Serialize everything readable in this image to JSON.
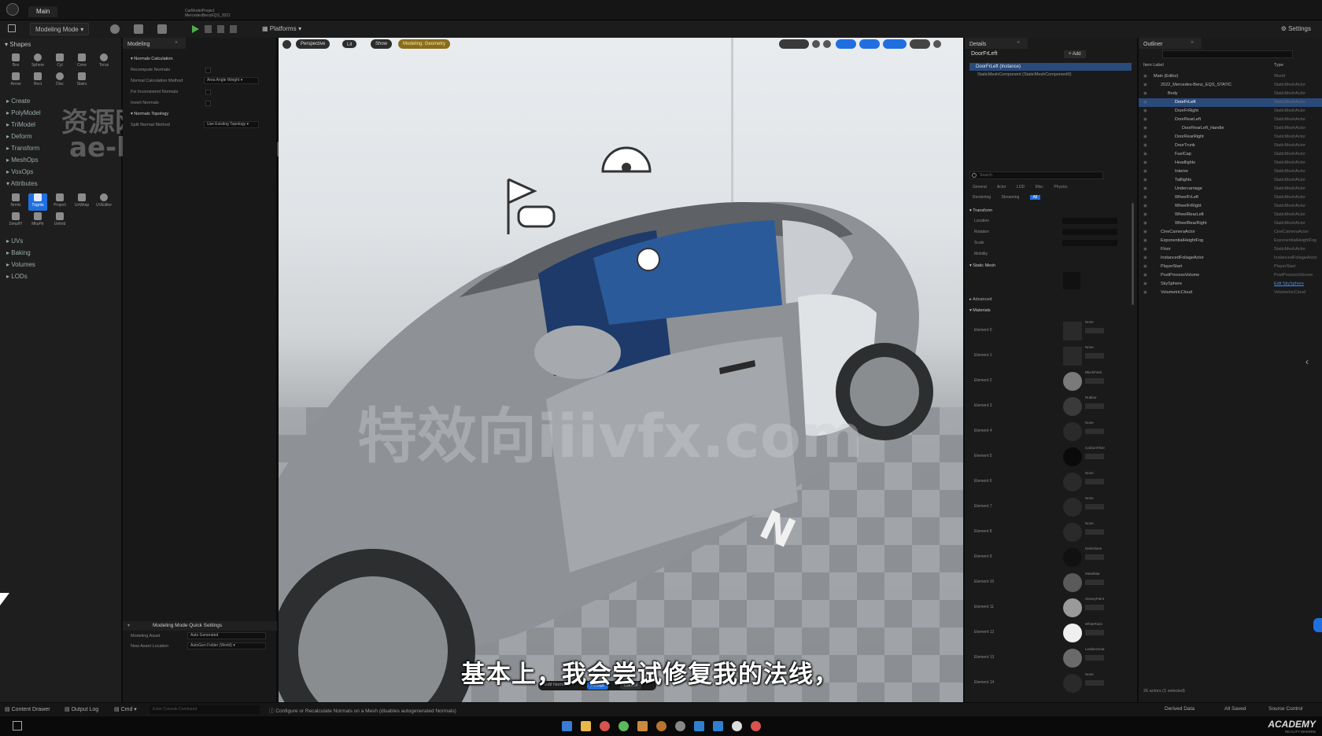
{
  "titlebar": {
    "tab": "Main",
    "project_line1": "CarModelProject",
    "project_line2": "MercedesBenzEQS_2021"
  },
  "toolbar": {
    "mode": "Modeling Mode",
    "platforms": "Platforms",
    "settings": "Settings"
  },
  "shapes": {
    "header": "Shapes",
    "row1": [
      "Box",
      "Sphere",
      "Cyl",
      "Cone",
      "Torus"
    ],
    "row2": [
      "Arrow",
      "Rect",
      "Disc",
      "Stairs"
    ],
    "categories_top": [
      "Create",
      "PolyModel",
      "TriModel",
      "Deform",
      "Transform",
      "MeshOps",
      "VoxOps",
      "Attributes"
    ],
    "attr_row1": [
      "Nrmls",
      "Tngnts",
      "Project",
      "UnWrap",
      "UVEditor"
    ],
    "attr_row2": [
      "SimplfY",
      "MkpPtr",
      "Unfold"
    ],
    "categories_bottom": [
      "UVs",
      "Baking",
      "Volumes",
      "LODs"
    ]
  },
  "modeling": {
    "tab": "Modeling",
    "section1": "Normals Calculation",
    "rows": [
      {
        "label": "Recompute Normals",
        "value": ""
      },
      {
        "label": "Normal Calculation Method",
        "value": "Area Angle Weight"
      },
      {
        "label": "Fix Inconsistent Normals",
        "value": ""
      },
      {
        "label": "Invert Normals",
        "value": ""
      }
    ],
    "section2": "Normals Topology",
    "split_label": "Split Normal Method",
    "split_value": "Use Existing Topology",
    "quick_settings": "Modeling Mode Quick Settings",
    "qs_row1_label": "Modeling Asset",
    "qs_row1_value": "Auto Generated",
    "qs_row2_label": "New Asset Location",
    "qs_row2_value": "AutoGen Folder (World)"
  },
  "viewport": {
    "perspective": "Perspective",
    "lit": "Lit",
    "show": "Show",
    "mode_chip": "Modeling: Geometry",
    "accept": "Accept",
    "cancel": "Cancel",
    "tool_label": "Edit Normals",
    "subtitle": "基本上，我会尝试修复我的法线，",
    "watermark_cn": "资源网",
    "watermark_url": "ae-houdini.com",
    "watermark_center": "特效向iiivfx.com"
  },
  "details": {
    "tab": "Details",
    "actor": "DoorFrLeft",
    "add": "+ Add",
    "instance": "DoorFrLeft (Instance)",
    "component": "StaticMeshComponent (StaticMeshComponent0)",
    "search": "Search",
    "filters": [
      "General",
      "Actor",
      "LOD",
      "Misc",
      "Physics",
      "Rendering",
      "Streaming",
      "All"
    ],
    "transform": "Transform",
    "transform_rows": [
      "Location",
      "Rotation",
      "Scale",
      "Mobility"
    ],
    "static_mesh": "Static Mesh",
    "advanced": "Advanced",
    "materials": "Materials",
    "elements": [
      {
        "label": "Element 0",
        "mat": "None"
      },
      {
        "label": "Element 1",
        "mat": "None"
      },
      {
        "label": "Element 2",
        "mat": "BlackPaint"
      },
      {
        "label": "Element 3",
        "mat": "Rubber"
      },
      {
        "label": "Element 4",
        "mat": "None"
      },
      {
        "label": "Element 5",
        "mat": "CarbonFiber"
      },
      {
        "label": "Element 6",
        "mat": "None"
      },
      {
        "label": "Element 7",
        "mat": "None"
      },
      {
        "label": "Element 8",
        "mat": "None"
      },
      {
        "label": "Element 9",
        "mat": "DarkGlass"
      },
      {
        "label": "Element 10",
        "mat": "MetalMat"
      },
      {
        "label": "Element 11",
        "mat": "GlossyPaint"
      },
      {
        "label": "Element 12",
        "mat": "WhitePaint"
      },
      {
        "label": "Element 13",
        "mat": "LeatherSeat"
      },
      {
        "label": "Element 14",
        "mat": "None"
      }
    ]
  },
  "outliner": {
    "tab": "Outliner",
    "col_label": "Item Label",
    "col_type": "Type",
    "rows": [
      {
        "name": "Main (Editor)",
        "type": "World",
        "indent": 1
      },
      {
        "name": "2022_Mercedes-Benz_EQS_STATIC",
        "type": "StaticMeshActor",
        "indent": 2
      },
      {
        "name": "Body",
        "type": "StaticMeshActor",
        "indent": 3
      },
      {
        "name": "DoorFrLeft",
        "type": "StaticMeshActor",
        "indent": 4,
        "selected": true
      },
      {
        "name": "DoorFrRight",
        "type": "StaticMeshActor",
        "indent": 4
      },
      {
        "name": "DoorRearLeft",
        "type": "StaticMeshActor",
        "indent": 4
      },
      {
        "name": "DoorRearLeft_Handle",
        "type": "StaticMeshActor",
        "indent": 5
      },
      {
        "name": "DoorRearRight",
        "type": "StaticMeshActor",
        "indent": 4
      },
      {
        "name": "DoorTrunk",
        "type": "StaticMeshActor",
        "indent": 4
      },
      {
        "name": "FuelCap",
        "type": "StaticMeshActor",
        "indent": 4
      },
      {
        "name": "Headlights",
        "type": "StaticMeshActor",
        "indent": 4
      },
      {
        "name": "Interior",
        "type": "StaticMeshActor",
        "indent": 4
      },
      {
        "name": "Taillights",
        "type": "StaticMeshActor",
        "indent": 4
      },
      {
        "name": "Undercarriage",
        "type": "StaticMeshActor",
        "indent": 4
      },
      {
        "name": "WheelFrLeft",
        "type": "StaticMeshActor",
        "indent": 4
      },
      {
        "name": "WheelFrRight",
        "type": "StaticMeshActor",
        "indent": 4
      },
      {
        "name": "WheelRearLeft",
        "type": "StaticMeshActor",
        "indent": 4
      },
      {
        "name": "WheelRearRight",
        "type": "StaticMeshActor",
        "indent": 4
      },
      {
        "name": "CineCameraActor",
        "type": "CineCameraActor",
        "indent": 2
      },
      {
        "name": "ExponentialHeightFog",
        "type": "ExponentialHeightFog",
        "indent": 2
      },
      {
        "name": "Floor",
        "type": "StaticMeshActor",
        "indent": 2
      },
      {
        "name": "InstancedFoliageActor",
        "type": "InstancedFoliageActor",
        "indent": 2
      },
      {
        "name": "PlayerStart",
        "type": "PlayerStart",
        "indent": 2
      },
      {
        "name": "PostProcessVolume",
        "type": "PostProcessVolume",
        "indent": 2
      },
      {
        "name": "SkySphere",
        "type": "Edit SkySphere",
        "indent": 2,
        "link": true
      },
      {
        "name": "VolumetricCloud",
        "type": "VolumetricCloud",
        "indent": 2
      }
    ],
    "footer": "26 actors (1 selected)"
  },
  "statusbar": {
    "content_drawer": "Content Drawer",
    "output_log": "Output Log",
    "cmd": "Cmd",
    "cmd_placeholder": "Enter Console Command",
    "message": "Configure or Recalculate Normals on a Mesh (disables autogenerated Normals)",
    "derived": "Derived Data",
    "all_saved": "All Saved",
    "source_control": "Source Control"
  },
  "brand": {
    "logo": "ACADEMY",
    "sub": "REALITY MAKERS"
  },
  "colors": {
    "accent": "#1f6fe0",
    "selected_row": "#2a4a7a",
    "panel": "#1a1a1a"
  }
}
